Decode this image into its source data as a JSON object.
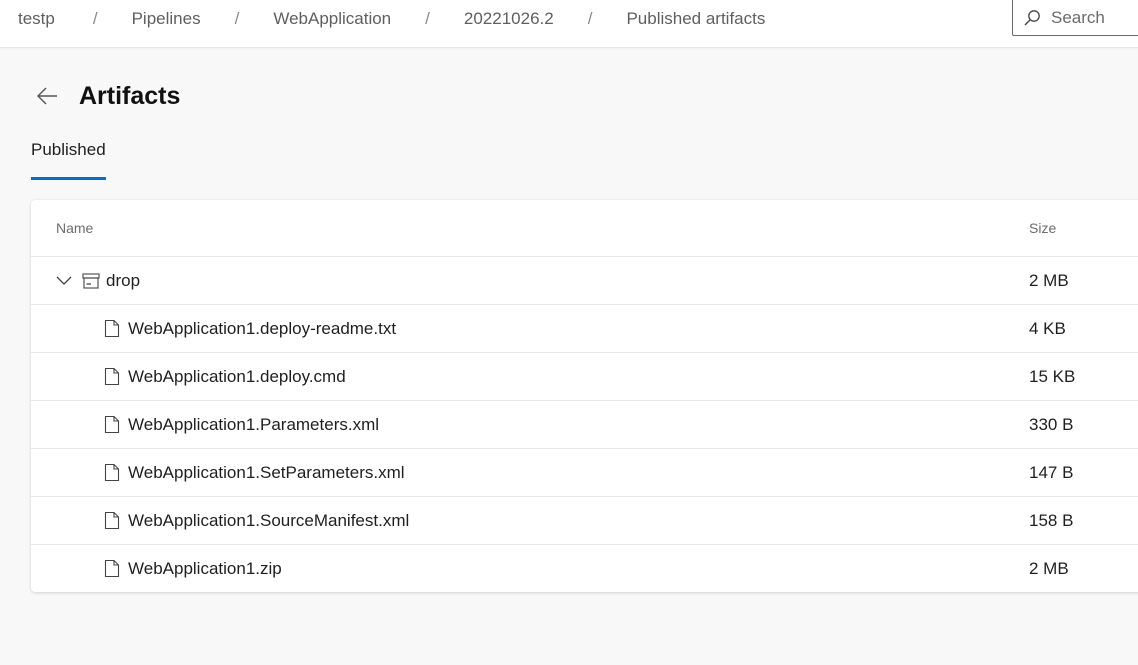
{
  "breadcrumb": [
    "testp",
    "Pipelines",
    "WebApplication",
    "20221026.2",
    "Published artifacts"
  ],
  "search": {
    "placeholder": "Search"
  },
  "page": {
    "title": "Artifacts"
  },
  "tabs": [
    {
      "label": "Published",
      "active": true
    }
  ],
  "accent_color": "#0f6cbd",
  "table": {
    "columns": {
      "name": "Name",
      "size": "Size"
    },
    "folder": {
      "name": "drop",
      "size": "2 MB",
      "expanded": true,
      "icon": "artifact-folder-icon"
    },
    "files": [
      {
        "name": "WebApplication1.deploy-readme.txt",
        "size": "4 KB",
        "icon": "file-icon"
      },
      {
        "name": "WebApplication1.deploy.cmd",
        "size": "15 KB",
        "icon": "file-icon"
      },
      {
        "name": "WebApplication1.Parameters.xml",
        "size": "330 B",
        "icon": "file-icon"
      },
      {
        "name": "WebApplication1.SetParameters.xml",
        "size": "147 B",
        "icon": "file-icon"
      },
      {
        "name": "WebApplication1.SourceManifest.xml",
        "size": "158 B",
        "icon": "file-icon"
      },
      {
        "name": "WebApplication1.zip",
        "size": "2 MB",
        "icon": "file-icon"
      }
    ]
  }
}
